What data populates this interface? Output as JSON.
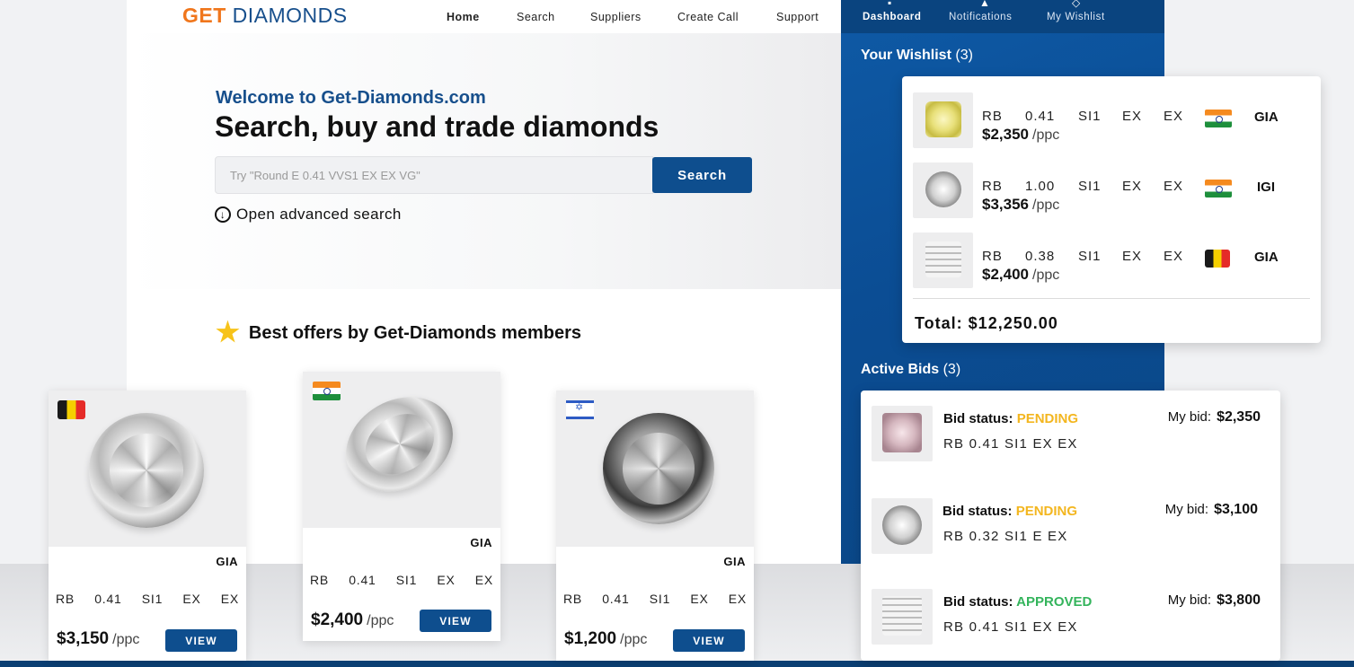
{
  "brand": {
    "logo_get": "GET",
    "logo_diamonds": "DIAMONDS"
  },
  "nav": {
    "home": "Home",
    "search": "Search",
    "suppliers": "Suppliers",
    "create_call": "Create Call",
    "support": "Support"
  },
  "side_nav": {
    "dashboard": "Dashboard",
    "notifications": "Notifications",
    "wishlist": "My Wishlist"
  },
  "hero": {
    "welcome": "Welcome to Get-Diamonds.com",
    "headline": "Search, buy and trade diamonds",
    "search_placeholder": "Try \"Round E 0.41 VVS1 EX EX VG\"",
    "search_button": "Search",
    "advanced": "Open advanced search"
  },
  "offers": {
    "title": "Best offers by Get-Diamonds members",
    "cards": [
      {
        "flag": "belgium",
        "lab": "GIA",
        "specs": [
          "RB",
          "0.41",
          "SI1",
          "EX",
          "EX"
        ],
        "price": "$3,150",
        "unit": "/ppc",
        "button": "VIEW"
      },
      {
        "flag": "india",
        "lab": "GIA",
        "specs": [
          "RB",
          "0.41",
          "SI1",
          "EX",
          "EX"
        ],
        "price": "$2,400",
        "unit": "/ppc",
        "button": "VIEW"
      },
      {
        "flag": "israel",
        "lab": "GIA",
        "specs": [
          "RB",
          "0.41",
          "SI1",
          "EX",
          "EX"
        ],
        "price": "$1,200",
        "unit": "/ppc",
        "button": "VIEW"
      }
    ]
  },
  "wishlist": {
    "title": "Your Wishlist",
    "count": "(3)",
    "items": [
      {
        "specs": [
          "RB",
          "0.41",
          "SI1",
          "EX",
          "EX"
        ],
        "flag": "india",
        "lab": "GIA",
        "price": "$2,350",
        "unit": "/ppc"
      },
      {
        "specs": [
          "RB",
          "1.00",
          "SI1",
          "EX",
          "EX"
        ],
        "flag": "india",
        "lab": "IGI",
        "price": "$3,356",
        "unit": "/ppc"
      },
      {
        "specs": [
          "RB",
          "0.38",
          "SI1",
          "EX",
          "EX"
        ],
        "flag": "belgium",
        "lab": "GIA",
        "price": "$2,400",
        "unit": "/ppc"
      }
    ],
    "total_label": "Total:",
    "total_value": "$12,250.00"
  },
  "bids": {
    "title": "Active Bids",
    "count": "(3)",
    "status_label": "Bid status:",
    "my_bid_label": "My bid:",
    "items": [
      {
        "status": "PENDING",
        "specs": "RB  0.41  SI1  EX  EX",
        "amount": "$2,350"
      },
      {
        "status": "PENDING",
        "specs": "RB  0.32  SI1  E  EX",
        "amount": "$3,100"
      },
      {
        "status": "APPROVED",
        "specs": "RB  0.41  SI1  EX  EX",
        "amount": "$3,800"
      }
    ]
  },
  "colors": {
    "brand_blue": "#0e4e8e",
    "brand_orange": "#f0761c",
    "pending": "#f3b61f",
    "approved": "#34b45c"
  }
}
